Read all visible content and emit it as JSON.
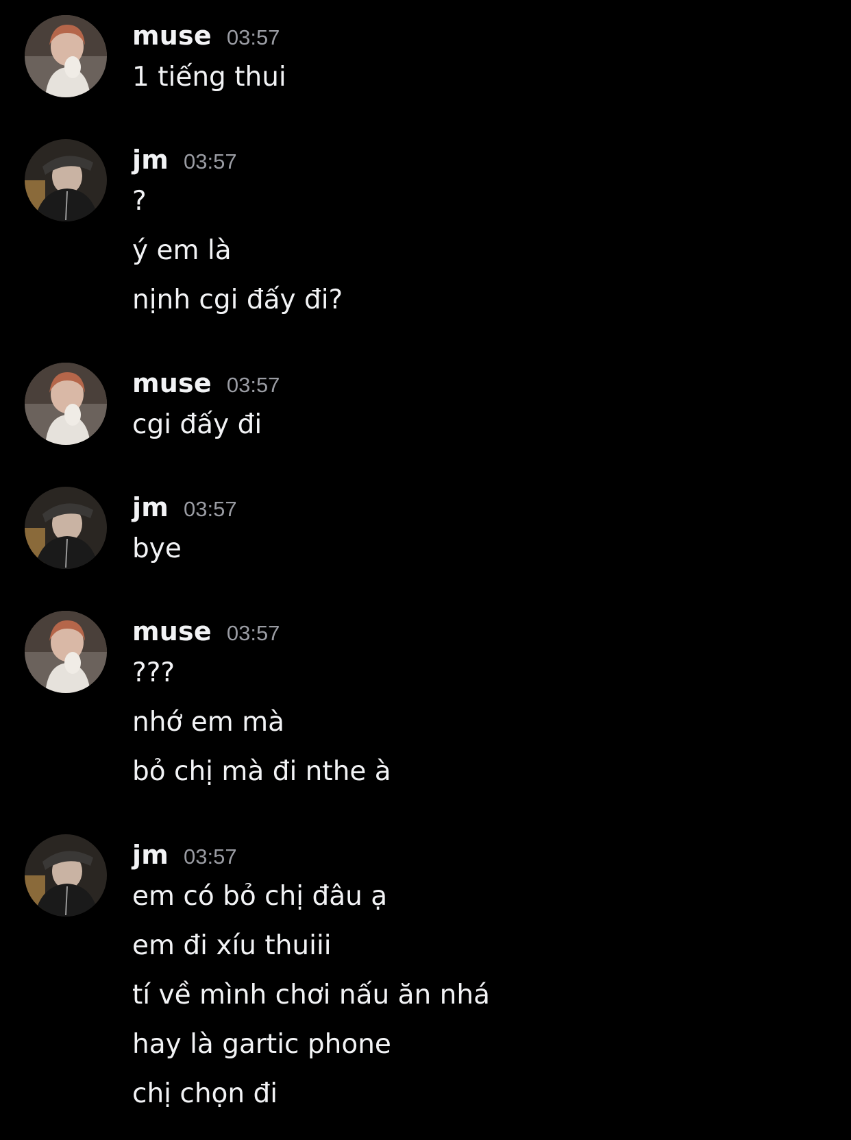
{
  "theme": {
    "background": "#000000",
    "text": "#f2f3f5",
    "timestamp": "#9a9ca3"
  },
  "messages": [
    {
      "author": "muse",
      "avatar": "muse-avatar",
      "time": "03:57",
      "lines": [
        "1 tiếng thui"
      ]
    },
    {
      "author": "jm",
      "avatar": "jm-avatar",
      "time": "03:57",
      "lines": [
        "?",
        "ý em là",
        "nịnh cgi đấy đi?"
      ]
    },
    {
      "author": "muse",
      "avatar": "muse-avatar",
      "time": "03:57",
      "lines": [
        "cgi đấy đi"
      ]
    },
    {
      "author": "jm",
      "avatar": "jm-avatar",
      "time": "03:57",
      "lines": [
        "bye"
      ]
    },
    {
      "author": "muse",
      "avatar": "muse-avatar",
      "time": "03:57",
      "lines": [
        "???",
        "nhớ em mà",
        "bỏ chị mà đi nthe à"
      ]
    },
    {
      "author": "jm",
      "avatar": "jm-avatar",
      "time": "03:57",
      "lines": [
        "em có bỏ chị đâu ạ",
        "em đi xíu thuiii",
        "tí về mình chơi nấu ăn nhá",
        "hay là gartic phone",
        "chị chọn đi"
      ]
    }
  ]
}
